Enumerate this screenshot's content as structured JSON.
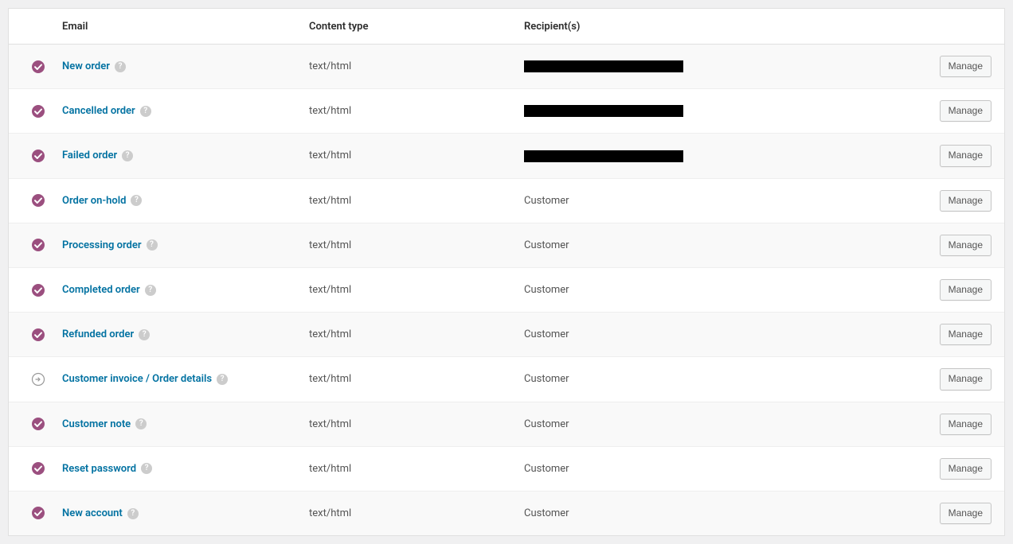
{
  "headers": {
    "email": "Email",
    "content_type": "Content type",
    "recipients": "Recipient(s)"
  },
  "manage_label": "Manage",
  "rows": [
    {
      "status": "enabled",
      "name": "New order",
      "content_type": "text/html",
      "recipient": "",
      "redacted": true
    },
    {
      "status": "enabled",
      "name": "Cancelled order",
      "content_type": "text/html",
      "recipient": "",
      "redacted": true
    },
    {
      "status": "enabled",
      "name": "Failed order",
      "content_type": "text/html",
      "recipient": "",
      "redacted": true
    },
    {
      "status": "enabled",
      "name": "Order on-hold",
      "content_type": "text/html",
      "recipient": "Customer",
      "redacted": false
    },
    {
      "status": "enabled",
      "name": "Processing order",
      "content_type": "text/html",
      "recipient": "Customer",
      "redacted": false
    },
    {
      "status": "enabled",
      "name": "Completed order",
      "content_type": "text/html",
      "recipient": "Customer",
      "redacted": false
    },
    {
      "status": "enabled",
      "name": "Refunded order",
      "content_type": "text/html",
      "recipient": "Customer",
      "redacted": false
    },
    {
      "status": "manual",
      "name": "Customer invoice / Order details",
      "content_type": "text/html",
      "recipient": "Customer",
      "redacted": false
    },
    {
      "status": "enabled",
      "name": "Customer note",
      "content_type": "text/html",
      "recipient": "Customer",
      "redacted": false
    },
    {
      "status": "enabled",
      "name": "Reset password",
      "content_type": "text/html",
      "recipient": "Customer",
      "redacted": false
    },
    {
      "status": "enabled",
      "name": "New account",
      "content_type": "text/html",
      "recipient": "Customer",
      "redacted": false
    }
  ]
}
